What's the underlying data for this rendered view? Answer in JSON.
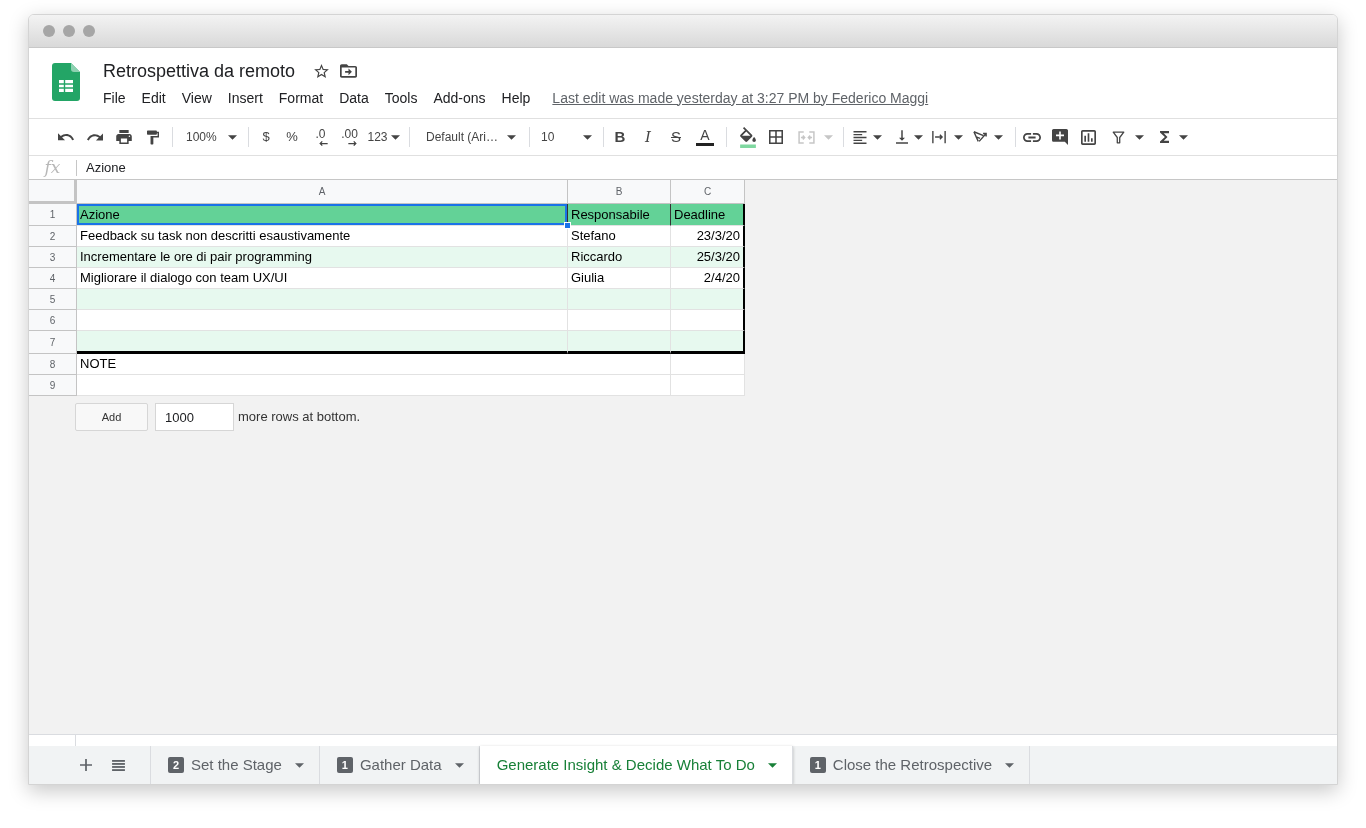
{
  "header": {
    "title": "Retrospettiva da remoto",
    "menu": [
      "File",
      "Edit",
      "View",
      "Insert",
      "Format",
      "Data",
      "Tools",
      "Add-ons",
      "Help"
    ],
    "last_edit": "Last edit was made yesterday at 3:27 PM by Federico Maggi"
  },
  "toolbar": {
    "zoom": "100%",
    "currency": "$",
    "percent": "%",
    "decrease_decimals": ".0",
    "increase_decimals": ".00",
    "number_format": "123",
    "font": "Default (Ari…",
    "font_size": "10",
    "bold": "B",
    "italic": "I",
    "strikethrough": "S",
    "text_color": "A",
    "merge": {
      "disabled": true
    }
  },
  "formula_bar": {
    "label": "fx",
    "value": "Azione"
  },
  "grid": {
    "columns": [
      "A",
      "B",
      "C"
    ],
    "table_rows": [
      {
        "number": "1",
        "kind": "header",
        "cells": [
          {
            "kind": "text",
            "text": "Azione",
            "selected": true
          },
          {
            "kind": "text",
            "text": "Responsabile",
            "selected": false
          },
          {
            "kind": "text",
            "text": "Deadline",
            "selected": false
          }
        ]
      },
      {
        "number": "2",
        "kind": "plain",
        "cells": [
          {
            "kind": "text",
            "text": "Feedback su task non descritti esaustivamente",
            "selected": false
          },
          {
            "kind": "text",
            "text": "Stefano",
            "selected": false
          },
          {
            "kind": "date",
            "text": "23/3/20",
            "selected": false
          }
        ]
      },
      {
        "number": "3",
        "kind": "band",
        "cells": [
          {
            "kind": "text",
            "text": "Incrementare le ore di pair programming",
            "selected": false
          },
          {
            "kind": "text",
            "text": "Riccardo",
            "selected": false
          },
          {
            "kind": "date",
            "text": "25/3/20",
            "selected": false
          }
        ]
      },
      {
        "number": "4",
        "kind": "plain",
        "cells": [
          {
            "kind": "text",
            "text": "Migliorare il dialogo con team UX/UI",
            "selected": false
          },
          {
            "kind": "text",
            "text": "Giulia",
            "selected": false
          },
          {
            "kind": "date",
            "text": "2/4/20",
            "selected": false
          }
        ]
      },
      {
        "number": "5",
        "kind": "band",
        "cells": [
          {
            "kind": "blank",
            "selected": false
          },
          {
            "kind": "blank",
            "selected": false
          },
          {
            "kind": "blank",
            "selected": false
          }
        ]
      },
      {
        "number": "6",
        "kind": "plain",
        "cells": [
          {
            "kind": "blank",
            "selected": false
          },
          {
            "kind": "blank",
            "selected": false
          },
          {
            "kind": "blank",
            "selected": false
          }
        ]
      },
      {
        "number": "7",
        "kind": "band",
        "cells": [
          {
            "kind": "blank",
            "selected": false
          },
          {
            "kind": "blank",
            "selected": false
          },
          {
            "kind": "blank",
            "selected": false
          }
        ]
      }
    ],
    "rows_below": [
      {
        "number": "8",
        "cells": [
          {
            "kind": "wide",
            "text": "NOTE",
            "selected": false
          },
          {
            "kind": "blank",
            "selected": false
          }
        ]
      },
      {
        "number": "9",
        "cells": [
          {
            "kind": "wide",
            "selected": false
          },
          {
            "kind": "blank",
            "selected": false
          }
        ]
      }
    ]
  },
  "add_rows": {
    "button": "Add",
    "value": "1000",
    "suffix": "more rows at bottom."
  },
  "sheets": [
    {
      "badge": "2",
      "label": "Set the Stage",
      "selected": false
    },
    {
      "badge": "1",
      "label": "Gather Data",
      "selected": false
    },
    {
      "label": "Generate Insight & Decide What To Do",
      "selected": true
    },
    {
      "badge": "1",
      "label": "Close the Retrospective",
      "selected": false
    }
  ]
}
